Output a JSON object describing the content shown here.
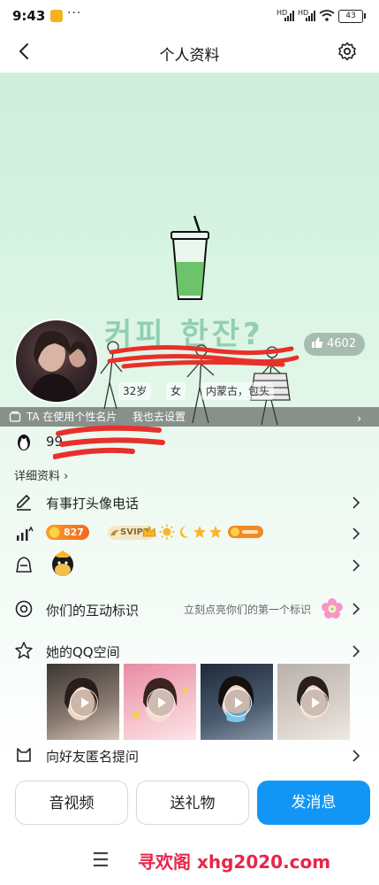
{
  "status_bar": {
    "time": "9:43",
    "dots": "···",
    "signal_1": "HD",
    "signal_2": "HD",
    "battery": "43"
  },
  "header": {
    "title": "个人资料"
  },
  "cover": {
    "lyric": "커피 한잔?",
    "likes": "4602",
    "tags": [
      "32岁",
      "女",
      "内蒙古，包头"
    ],
    "card_text": "TA 在使用个性名片",
    "card_link": "我也去设置"
  },
  "profile": {
    "qq_partial": "99",
    "detail_link": "详细资料"
  },
  "rows": {
    "video_call": "有事打头像电话",
    "badges": {
      "level_num": "827",
      "svip": "SVIP8"
    },
    "interaction_label": "你们的互动标识",
    "interaction_hint": "立刻点亮你们的第一个标识",
    "qzone": "她的QQ空间",
    "anon_question": "向好友匿名提问"
  },
  "actions": {
    "av": "音视频",
    "gift": "送礼物",
    "message": "发消息"
  },
  "watermark": "寻欢阁 xhg2020.com",
  "colors": {
    "primary_button": "#1296f5",
    "cover_bg": "#d6f3e1",
    "watermark": "#e8254a",
    "redaction": "#e8302a"
  }
}
